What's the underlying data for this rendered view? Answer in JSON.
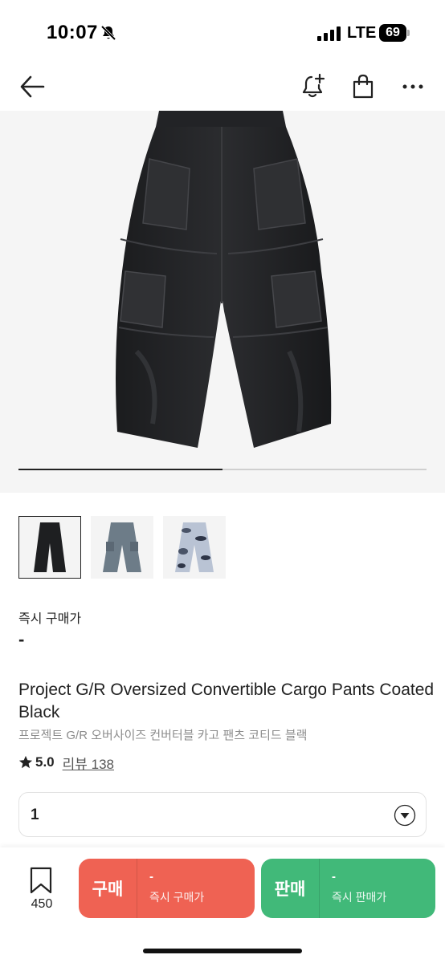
{
  "status_bar": {
    "time": "10:07",
    "network": "LTE",
    "battery": "69",
    "icons": [
      "mute-icon",
      "signal-icon",
      "battery-icon"
    ]
  },
  "nav": {
    "icons": [
      "back-arrow-icon",
      "bell-plus-icon",
      "shopping-bag-icon",
      "more-dots-icon"
    ]
  },
  "gallery": {
    "image": "black-cargo-pants",
    "progress": 0.5,
    "thumbnails": [
      "black-cargo-pants",
      "blue-denim-cargo-pants",
      "camo-cargo-pants"
    ],
    "selected_index": 0
  },
  "price": {
    "label": "즉시 구매가",
    "value": "-"
  },
  "product": {
    "title": "Project G/R Oversized Convertible Cargo Pants Coated Black",
    "subtitle": "프로젝트 G/R 오버사이즈 컨버터블 카고 팬츠 코티드 블랙",
    "rating": "5.0",
    "review_link": "리뷰 138"
  },
  "size_select": {
    "value": "1"
  },
  "bottom_bar": {
    "wish_count": "450",
    "buy": {
      "label": "구매",
      "price": "-",
      "sub": "즉시 구매가",
      "color": "#ef6253"
    },
    "sell": {
      "label": "판매",
      "price": "-",
      "sub": "즉시 판매가",
      "color": "#41b979"
    }
  }
}
